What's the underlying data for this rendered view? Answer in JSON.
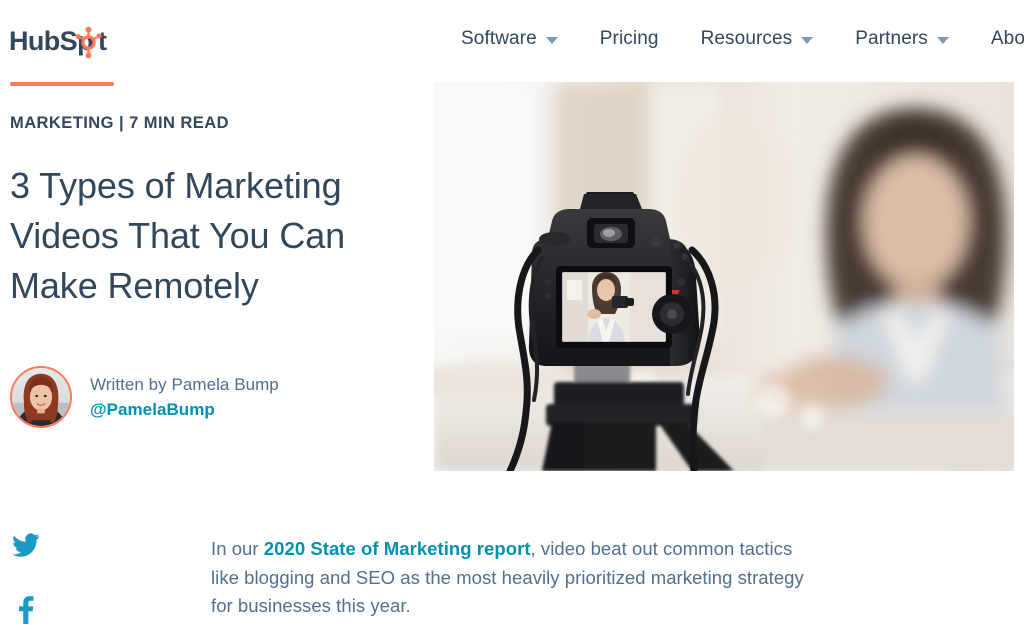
{
  "header": {
    "logo": {
      "name": "hubspot-logo",
      "text_dark_1": "HubSp",
      "text_dark_2": "t",
      "dark_color": "#33475b",
      "accent_color": "#ff7a59"
    },
    "nav": [
      {
        "label": "Software",
        "has_dropdown": true,
        "icon": "chevron-down-icon"
      },
      {
        "label": "Pricing",
        "has_dropdown": false,
        "icon": ""
      },
      {
        "label": "Resources",
        "has_dropdown": true,
        "icon": "chevron-down-icon"
      },
      {
        "label": "Partners",
        "has_dropdown": true,
        "icon": "chevron-down-icon"
      },
      {
        "label": "About",
        "has_dropdown": true,
        "icon": "chevron-down-icon"
      }
    ]
  },
  "article": {
    "category_line": "MARKETING | 7 MIN READ",
    "category": "MARKETING",
    "read_time": "7 MIN READ",
    "title": "3 Types of Marketing Videos That You Can Make Remotely",
    "accent_rule_color": "#ff7a59",
    "author": {
      "written_by": "Written by Pamela Bump",
      "name": "Pamela Bump",
      "handle": "@PamelaBump",
      "handle_color": "#0091ae",
      "avatar_alt": "Pamela Bump headshot"
    },
    "hero_image": {
      "alt": "DSLR camera on a tripod recording a woman seated at a desk",
      "caption": ""
    },
    "body": {
      "lead_before": "In our ",
      "lead_link": "2020 State of Marketing report",
      "lead_after": ", video beat out common tactics like blogging and SEO as the most heavily prioritized marketing strategy for businesses this year.",
      "link_color": "#0091ae",
      "text_color": "#516f90"
    }
  },
  "social_share": {
    "items": [
      {
        "label": "Share on Twitter",
        "icon": "twitter-icon",
        "color": "#1a9ac4"
      },
      {
        "label": "Share on Facebook",
        "icon": "facebook-icon",
        "color": "#1a9ac4"
      }
    ]
  },
  "colors": {
    "text_primary": "#33475b",
    "text_secondary": "#516f90",
    "accent_orange": "#ff7a59",
    "accent_teal": "#0091ae",
    "background": "#ffffff"
  }
}
